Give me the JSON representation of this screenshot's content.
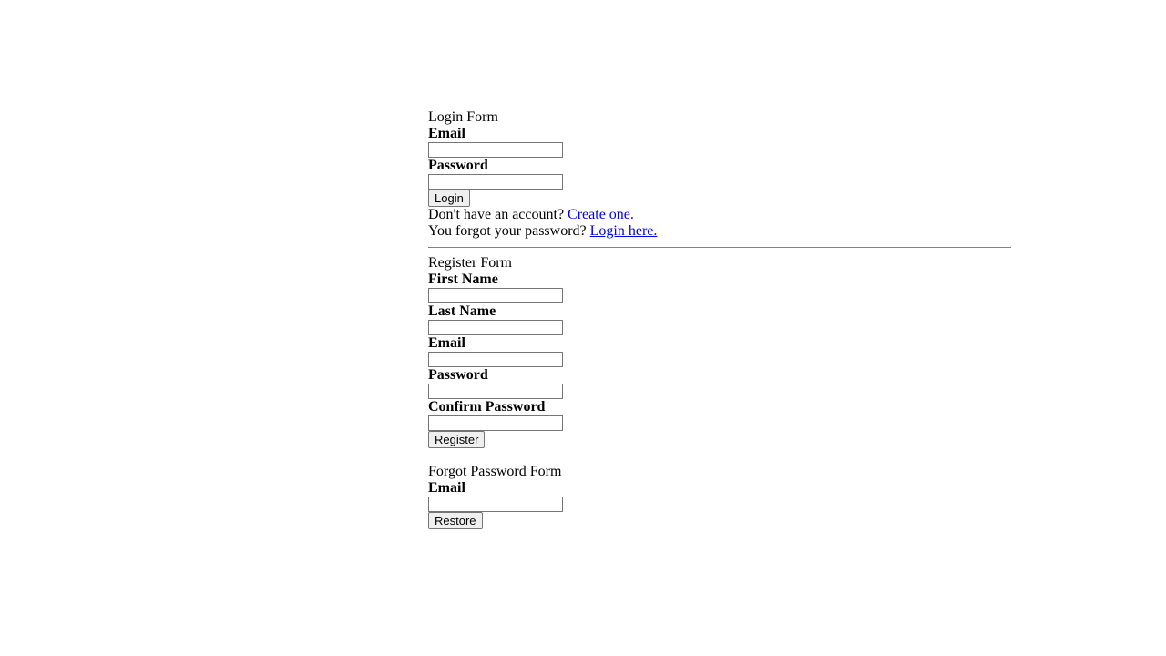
{
  "login": {
    "title": "Login Form",
    "email_label": "Email",
    "password_label": "Password",
    "button_label": "Login",
    "no_account_text": "Don't have an account? ",
    "create_link": "Create one.",
    "forgot_text": "You forgot your password? ",
    "login_here_link": "Login here."
  },
  "register": {
    "title": "Register Form",
    "first_name_label": "First Name",
    "last_name_label": "Last Name",
    "email_label": "Email",
    "password_label": "Password",
    "confirm_password_label": "Confirm Password",
    "button_label": "Register"
  },
  "forgot": {
    "title": "Forgot Password Form",
    "email_label": "Email",
    "button_label": "Restore"
  }
}
